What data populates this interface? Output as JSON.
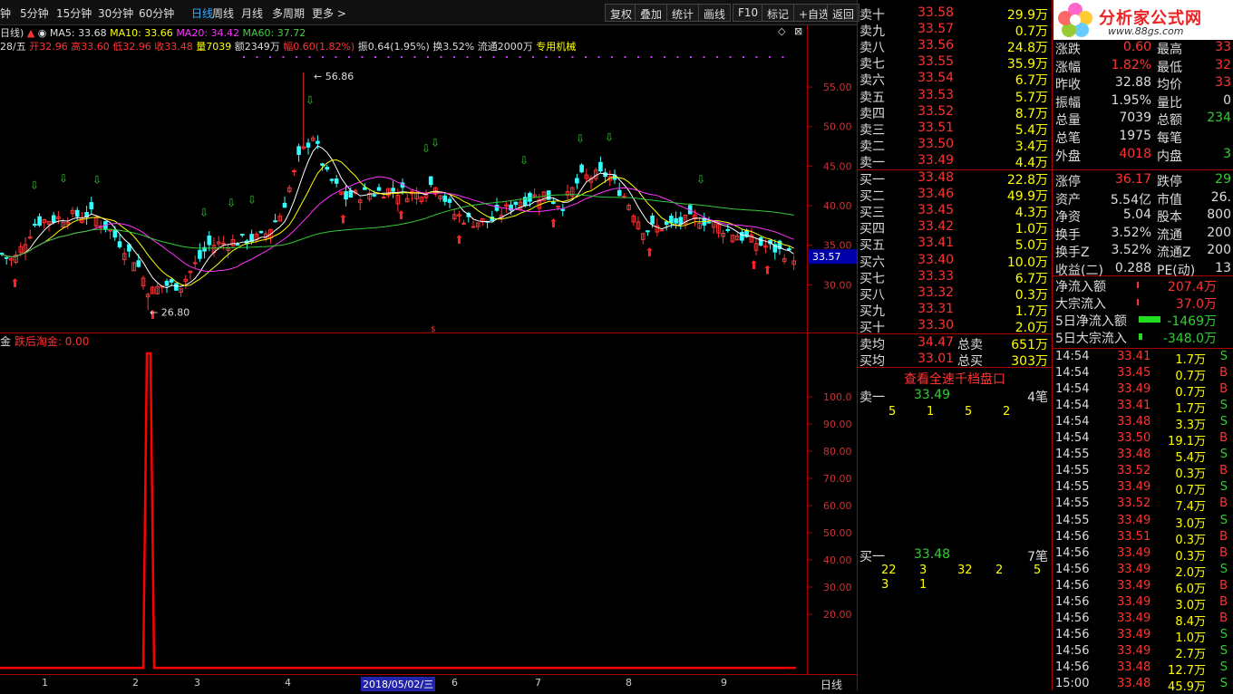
{
  "periods": [
    "钟",
    "5分钟",
    "15分钟",
    "30分钟",
    "60分钟",
    "日线",
    "周线",
    "月线",
    "多周期",
    "更多 >"
  ],
  "active_period": "日线",
  "toolbar": [
    "复权",
    "叠加",
    "统计",
    "画线",
    "F10",
    "标记",
    "+自选",
    "返回"
  ],
  "ma_line": {
    "label": "日线)",
    "ma5": "MA5: 33.68",
    "ma10": "MA10: 33.66",
    "ma20": "MA20: 34.42",
    "ma60": "MA60: 37.72"
  },
  "ohlc_line": {
    "prefix": "28/五",
    "open": "开32.96",
    "high": "高33.60",
    "low": "低32.96",
    "close": "收33.48",
    "vol": "量7039",
    "amount": "额2349万",
    "change": "幅0.60(1.82%)",
    "amp": "振0.64(1.95%)",
    "turnover": "换3.52%",
    "float": "流通2000万",
    "sector": "专用机械"
  },
  "price_ticks": [
    "55.00",
    "50.00",
    "45.00",
    "40.00",
    "35.00",
    "30.00"
  ],
  "high_mark": "56.86",
  "low_mark": "26.80",
  "last_price": "33.57",
  "indicator": {
    "name": "金",
    "formula": "跌后淘金: 0.00"
  },
  "ind_ticks": [
    "100.0",
    "90.00",
    "80.00",
    "70.00",
    "60.00",
    "50.00",
    "40.00",
    "30.00",
    "20.00"
  ],
  "date_axis": [
    "1",
    "2",
    "3",
    "4",
    "2018/05/02/三",
    "6",
    "7",
    "8",
    "9"
  ],
  "period_label": "日线",
  "sell": [
    {
      "l": "卖十",
      "p": "33.58",
      "v": "29.9万"
    },
    {
      "l": "卖九",
      "p": "33.57",
      "v": "0.7万"
    },
    {
      "l": "卖八",
      "p": "33.56",
      "v": "24.8万"
    },
    {
      "l": "卖七",
      "p": "33.55",
      "v": "35.9万"
    },
    {
      "l": "卖六",
      "p": "33.54",
      "v": "6.7万"
    },
    {
      "l": "卖五",
      "p": "33.53",
      "v": "5.7万"
    },
    {
      "l": "卖四",
      "p": "33.52",
      "v": "8.7万"
    },
    {
      "l": "卖三",
      "p": "33.51",
      "v": "5.4万"
    },
    {
      "l": "卖二",
      "p": "33.50",
      "v": "3.4万"
    },
    {
      "l": "卖一",
      "p": "33.49",
      "v": "4.4万"
    }
  ],
  "buy": [
    {
      "l": "买一",
      "p": "33.48",
      "v": "22.8万"
    },
    {
      "l": "买二",
      "p": "33.46",
      "v": "49.9万"
    },
    {
      "l": "买三",
      "p": "33.45",
      "v": "4.3万"
    },
    {
      "l": "买四",
      "p": "33.42",
      "v": "1.0万"
    },
    {
      "l": "买五",
      "p": "33.41",
      "v": "5.0万"
    },
    {
      "l": "买六",
      "p": "33.40",
      "v": "10.0万"
    },
    {
      "l": "买七",
      "p": "33.33",
      "v": "6.7万"
    },
    {
      "l": "买八",
      "p": "33.32",
      "v": "0.3万"
    },
    {
      "l": "买九",
      "p": "33.31",
      "v": "1.7万"
    },
    {
      "l": "买十",
      "p": "33.30",
      "v": "2.0万"
    }
  ],
  "avg": {
    "sell_label": "卖均",
    "sell_price": "34.47",
    "sell_total_label": "总卖",
    "sell_total": "651万",
    "buy_label": "买均",
    "buy_price": "33.01",
    "buy_total_label": "总买",
    "buy_total": "303万"
  },
  "level2_btn": "查看全速千档盘口",
  "sell1": {
    "label": "卖一",
    "price": "33.49",
    "count": "4笔",
    "orders": [
      "5",
      "1",
      "5",
      "2"
    ]
  },
  "buy1": {
    "label": "买一",
    "price": "33.48",
    "count": "7笔",
    "orders": [
      "22",
      "3",
      "32",
      "2",
      "5",
      "3",
      "1"
    ]
  },
  "logo": {
    "text": "分析家公式网",
    "url": "www.88gs.com"
  },
  "stats": [
    [
      "涨跌",
      "0.60",
      "最高",
      "33"
    ],
    [
      "涨幅",
      "1.82%",
      "最低",
      "32"
    ],
    [
      "昨收",
      "32.88",
      "均价",
      "33"
    ],
    [
      "振幅",
      "1.95%",
      "量比",
      "0"
    ],
    [
      "总量",
      "7039",
      "总额",
      "234"
    ],
    [
      "总笔",
      "1975",
      "每笔",
      ""
    ],
    [
      "外盘",
      "4018",
      "内盘",
      "3"
    ],
    [
      "涨停",
      "36.17",
      "跌停",
      "29"
    ],
    [
      "资产",
      "5.54亿",
      "市值",
      "26."
    ],
    [
      "净资",
      "5.04",
      "股本",
      "800"
    ],
    [
      "换手",
      "3.52%",
      "流通",
      "200"
    ],
    [
      "换手Z",
      "3.52%",
      "流通Z",
      "200"
    ],
    [
      "收益(二)",
      "0.288",
      "PE(动)",
      "13"
    ]
  ],
  "flows": [
    {
      "l": "净流入额",
      "v": "207.4万"
    },
    {
      "l": "大宗流入",
      "v": "37.0万"
    },
    {
      "l": "5日净流入额",
      "v": "-1469万"
    },
    {
      "l": "5日大宗流入",
      "v": "-348.0万"
    }
  ],
  "ticks": [
    [
      "14:54",
      "33.41",
      "1.7万",
      "S"
    ],
    [
      "14:54",
      "33.45",
      "0.7万",
      "B"
    ],
    [
      "14:54",
      "33.49",
      "0.7万",
      "B"
    ],
    [
      "14:54",
      "33.41",
      "1.7万",
      "S"
    ],
    [
      "14:54",
      "33.48",
      "3.3万",
      "S"
    ],
    [
      "14:54",
      "33.50",
      "19.1万",
      "B"
    ],
    [
      "14:55",
      "33.48",
      "5.4万",
      "S"
    ],
    [
      "14:55",
      "33.52",
      "0.3万",
      "B"
    ],
    [
      "14:55",
      "33.49",
      "0.7万",
      "S"
    ],
    [
      "14:55",
      "33.52",
      "7.4万",
      "B"
    ],
    [
      "14:55",
      "33.49",
      "3.0万",
      "S"
    ],
    [
      "14:56",
      "33.51",
      "0.3万",
      "B"
    ],
    [
      "14:56",
      "33.49",
      "0.3万",
      "B"
    ],
    [
      "14:56",
      "33.49",
      "2.0万",
      "S"
    ],
    [
      "14:56",
      "33.49",
      "6.0万",
      "B"
    ],
    [
      "14:56",
      "33.49",
      "3.0万",
      "B"
    ],
    [
      "14:56",
      "33.49",
      "8.4万",
      "B"
    ],
    [
      "14:56",
      "33.49",
      "1.0万",
      "S"
    ],
    [
      "14:56",
      "33.49",
      "2.7万",
      "S"
    ],
    [
      "14:56",
      "33.48",
      "12.7万",
      "S"
    ],
    [
      "15:00",
      "33.48",
      "45.9万",
      "S"
    ]
  ],
  "colors": {
    "up": "#ff3333",
    "down": "#33ffff",
    "ma5": "#ffffff",
    "ma10": "#ffff00",
    "ma20": "#ff33ff",
    "ma60": "#33cc33",
    "signal": "#ff0000"
  }
}
